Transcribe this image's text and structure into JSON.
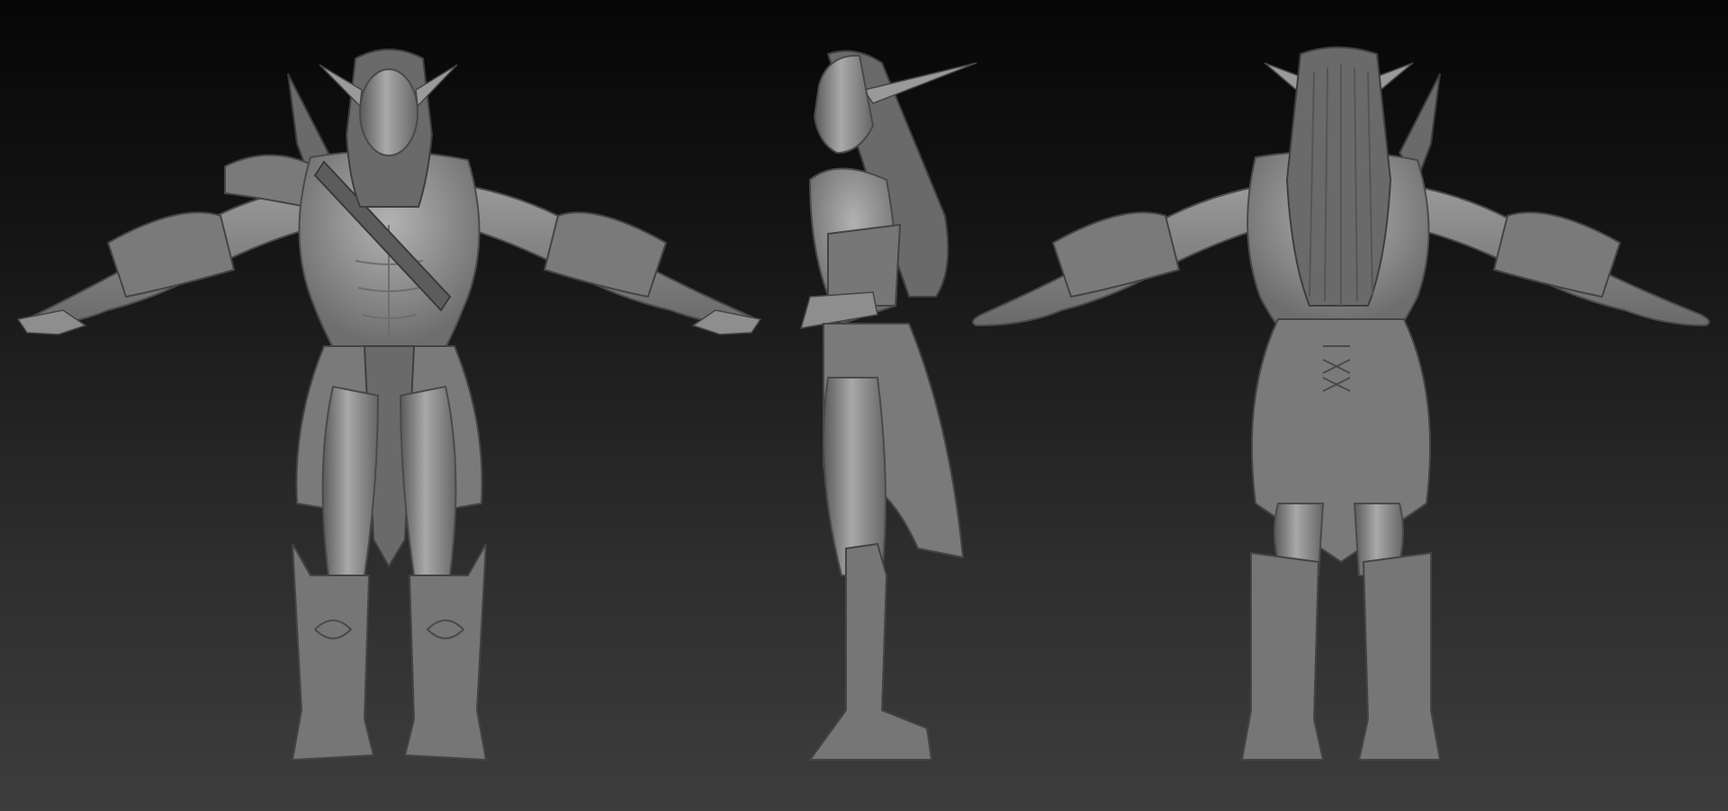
{
  "scene": {
    "subject": "",
    "views": [
      {
        "id": "front"
      },
      {
        "id": "side"
      },
      {
        "id": "back"
      }
    ]
  },
  "colors": {
    "background_top": "#060606",
    "background_bottom": "#3d3d3d",
    "clay_light": "#a7a7a7",
    "clay_mid": "#888888",
    "clay_dark": "#5a5a5a",
    "clay_shadow": "#3e3e3e"
  },
  "icons": {
    "front_view": "figure-front-icon",
    "side_view": "figure-side-icon",
    "back_view": "figure-back-icon"
  }
}
